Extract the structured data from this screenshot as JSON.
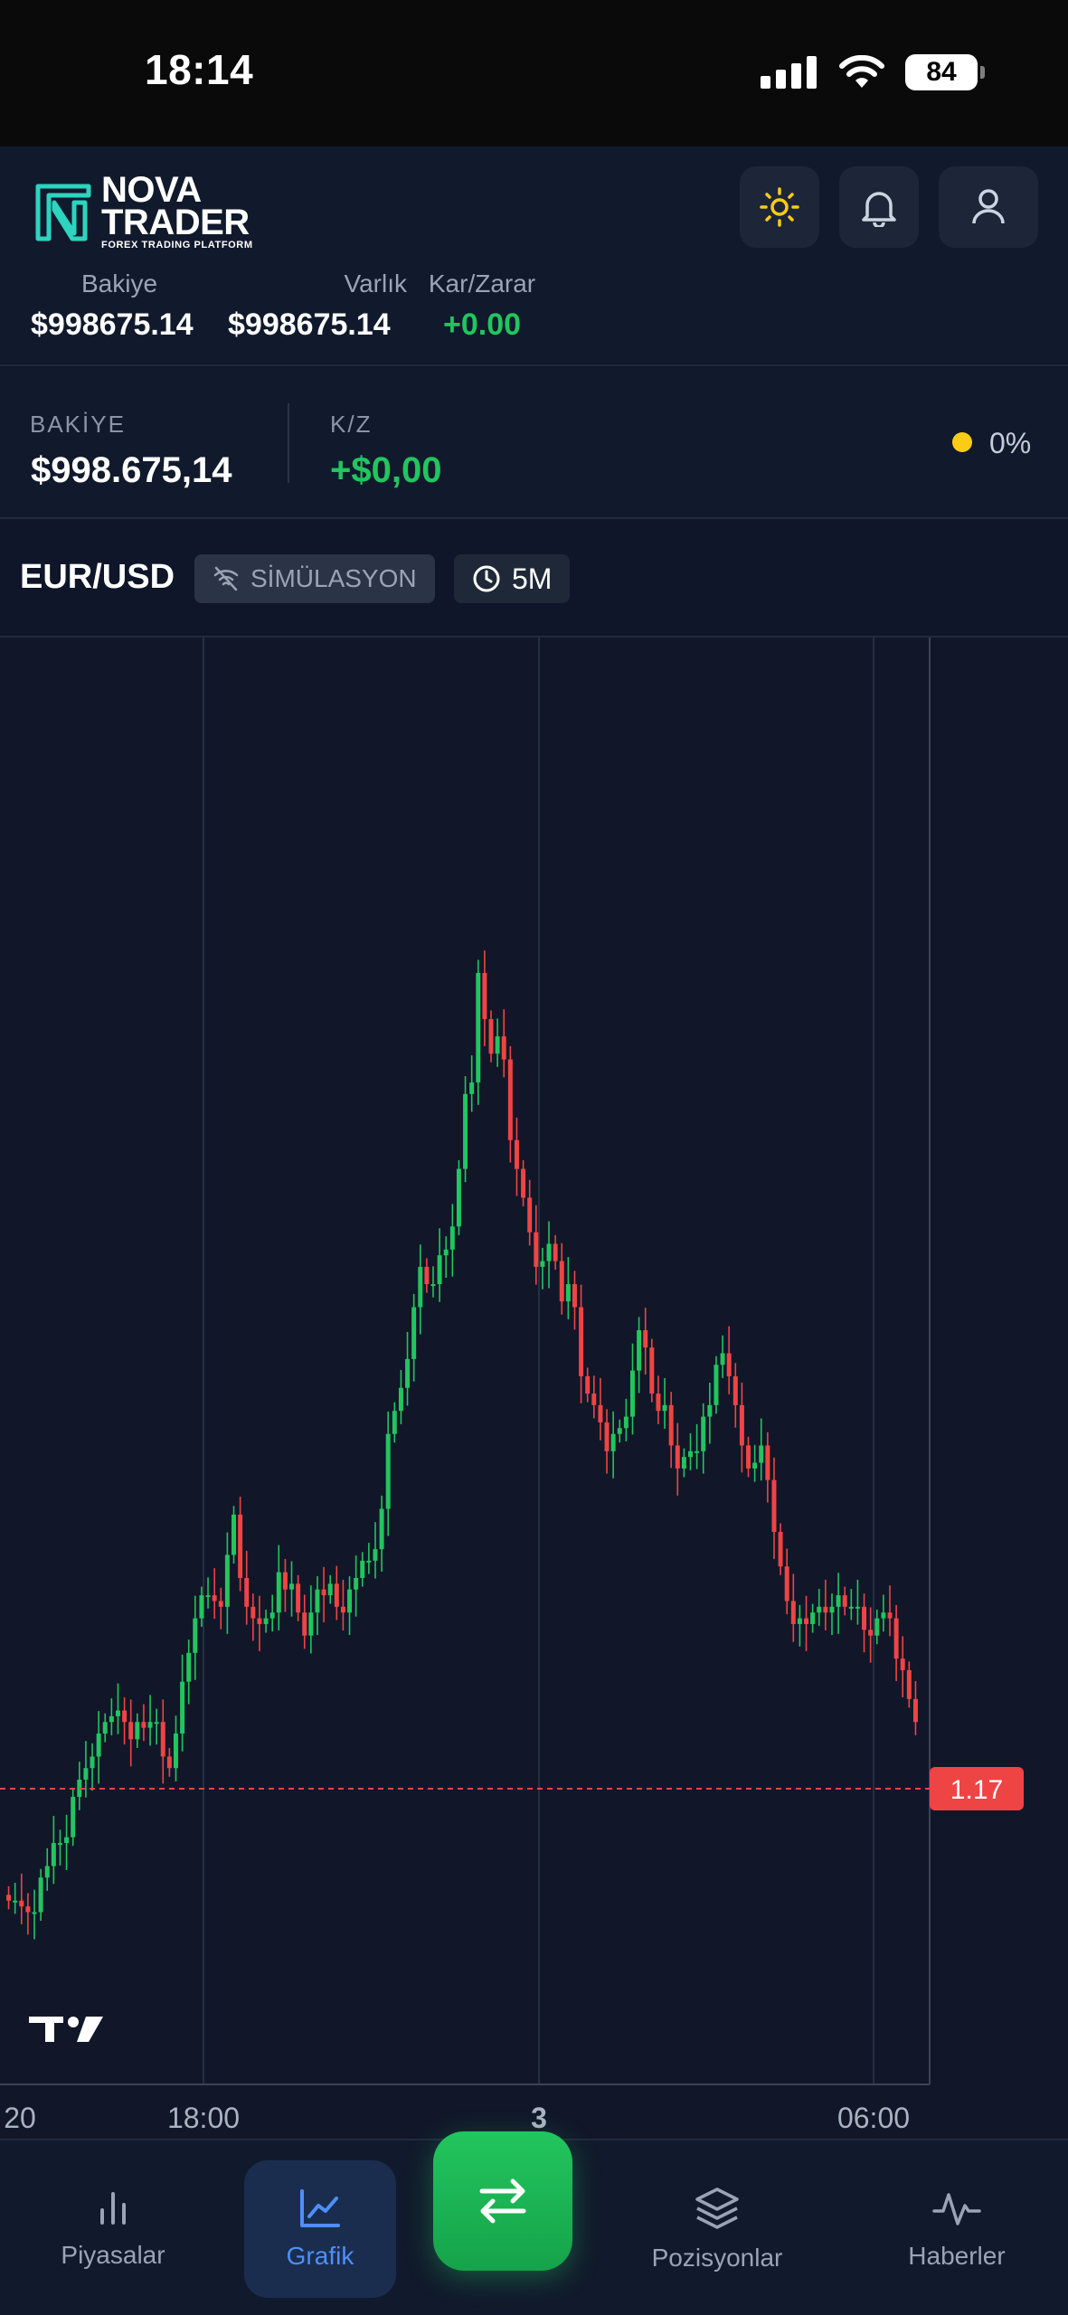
{
  "status_bar": {
    "time": "18:14",
    "battery": "84"
  },
  "header": {
    "logo_line1": "NOVA",
    "logo_line2": "TRADER",
    "logo_sub": "FOREX TRADING PLATFORM",
    "icons": [
      "sun-icon",
      "bell-icon",
      "user-icon"
    ]
  },
  "summary": {
    "balance_label": "Bakiye",
    "balance_value": "$998675.14",
    "equity_label": "Varlık",
    "equity_value": "$998675.14",
    "pl_label": "Kar/Zarar",
    "pl_value": "+0.00"
  },
  "balance_panel": {
    "balance_label": "BAKİYE",
    "balance_value": "$998.675,14",
    "pl_label": "K/Z",
    "pl_value": "+$0,00",
    "percent": "0%"
  },
  "chart_header": {
    "pair": "EUR/USD",
    "mode_label": "SİMÜLASYON",
    "timeframe": "5M"
  },
  "chart_data": {
    "type": "candlestick",
    "x_tick_labels": [
      "20",
      "18:00",
      "3",
      "06:00"
    ],
    "current_price_label": "1.17",
    "closes": [
      0.86,
      0.86,
      0.85,
      0.84,
      0.84,
      0.9,
      0.92,
      0.96,
      0.96,
      0.97,
      1.04,
      1.07,
      1.09,
      1.11,
      1.15,
      1.17,
      1.18,
      1.19,
      1.17,
      1.14,
      1.17,
      1.16,
      1.17,
      1.17,
      1.11,
      1.09,
      1.15,
      1.24,
      1.29,
      1.35,
      1.39,
      1.39,
      1.38,
      1.37,
      1.46,
      1.53,
      1.42,
      1.37,
      1.35,
      1.34,
      1.35,
      1.36,
      1.43,
      1.4,
      1.41,
      1.36,
      1.32,
      1.36,
      1.4,
      1.39,
      1.41,
      1.37,
      1.36,
      1.4,
      1.42,
      1.45,
      1.45,
      1.47,
      1.54,
      1.67,
      1.71,
      1.75,
      1.8,
      1.89,
      1.96,
      1.93,
      1.93,
      1.98,
      1.99,
      2.03,
      2.13,
      2.26,
      2.28,
      2.47,
      2.39,
      2.33,
      2.36,
      2.32,
      2.18,
      2.13,
      2.08,
      2.02,
      1.96,
      1.97,
      2.0,
      1.97,
      1.9,
      1.93,
      1.89,
      1.77,
      1.74,
      1.72,
      1.69,
      1.64,
      1.67,
      1.68,
      1.7,
      1.78,
      1.85,
      1.82,
      1.74,
      1.71,
      1.72,
      1.65,
      1.61,
      1.63,
      1.64,
      1.64,
      1.7,
      1.72,
      1.79,
      1.81,
      1.77,
      1.72,
      1.65,
      1.61,
      1.62,
      1.65,
      1.59,
      1.5,
      1.44,
      1.38,
      1.34,
      1.35,
      1.34,
      1.36,
      1.37,
      1.36,
      1.37,
      1.39,
      1.37,
      1.37,
      1.37,
      1.33,
      1.32,
      1.35,
      1.36,
      1.35,
      1.28,
      1.26,
      1.21,
      1.17
    ]
  },
  "nav": {
    "markets": "Piyasalar",
    "chart": "Grafik",
    "positions": "Pozisyonlar",
    "news": "Haberler"
  },
  "colors": {
    "up": "#22c55e",
    "down": "#ef4444",
    "accent": "#4d8ff8",
    "positive_text": "#22c55e",
    "indicator_dot": "#facc15"
  }
}
